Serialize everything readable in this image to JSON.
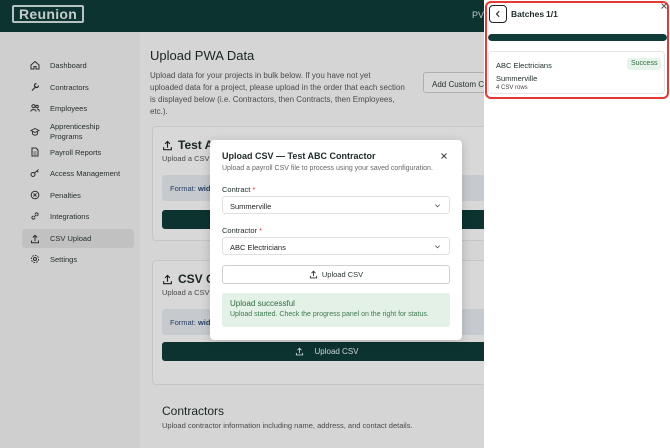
{
  "app": {
    "logo": "Reunion",
    "user_initials": "PV"
  },
  "sidebar": {
    "items": [
      {
        "label": "Dashboard",
        "icon": "home-icon"
      },
      {
        "label": "Contractors",
        "icon": "wrench-icon"
      },
      {
        "label": "Employees",
        "icon": "users-icon"
      },
      {
        "label": "Apprenticeship Programs",
        "icon": "graduation-cap-icon"
      },
      {
        "label": "Payroll Reports",
        "icon": "file-icon"
      },
      {
        "label": "Access Management",
        "icon": "key-icon"
      },
      {
        "label": "Penalties",
        "icon": "alert-circle-icon"
      },
      {
        "label": "Integrations",
        "icon": "link-icon"
      },
      {
        "label": "CSV Upload",
        "icon": "upload-icon",
        "active": true
      },
      {
        "label": "Settings",
        "icon": "gear-icon"
      }
    ]
  },
  "main": {
    "title": "Upload PWA Data",
    "description": "Upload data for your projects in bulk below. If you have not yet uploaded data for a project, please upload in the order that each section is displayed below (i.e. Contractors, then Contracts, then Employees, etc.).",
    "custom_button": "Add Custom CS",
    "section1": {
      "title": "Test A",
      "subtitle": "Upload a CSV",
      "format_label": "Format:",
      "format_value": "wid"
    },
    "section2": {
      "title": "CSV C",
      "subtitle": "Upload a CSV",
      "format_label": "Format:",
      "format_value": "wid",
      "button": "Upload CSV"
    },
    "contractors": {
      "title": "Contractors",
      "subtitle": "Upload contractor information including name, address, and contact details."
    }
  },
  "modal": {
    "title": "Upload CSV — Test ABC Contractor",
    "subtitle": "Upload a payroll CSV file to process using your saved configuration.",
    "contract_label": "Contract",
    "contract_value": "Summerville",
    "contractor_label": "Contractor",
    "contractor_value": "ABC Electricians",
    "required_mark": "*",
    "upload_button": "Upload CSV",
    "success_title": "Upload successful",
    "success_message": "Upload started. Check the progress panel on the right for status."
  },
  "panel": {
    "title": "Batches",
    "count": "1/1",
    "progress": 1.0,
    "batch": {
      "name": "ABC Electricians",
      "status": "Success",
      "project": "Summerville",
      "rows": "4 CSV rows"
    }
  },
  "colors": {
    "brand": "#0f3b38",
    "success": "#2e6b3f",
    "highlight": "#e53935"
  }
}
